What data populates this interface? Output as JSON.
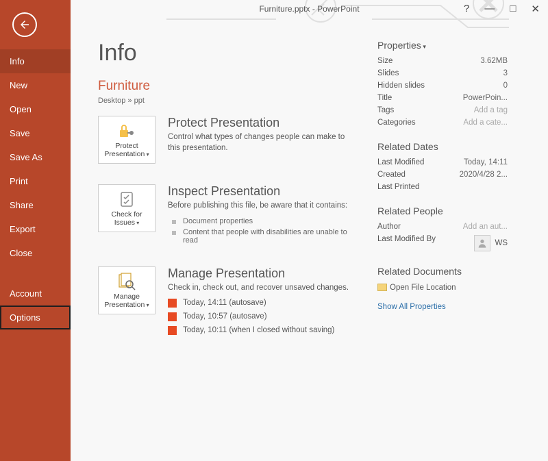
{
  "titlebar": "Furniture.pptx - PowerPoint",
  "sidebar": {
    "items": [
      {
        "label": "Info"
      },
      {
        "label": "New"
      },
      {
        "label": "Open"
      },
      {
        "label": "Save"
      },
      {
        "label": "Save As"
      },
      {
        "label": "Print"
      },
      {
        "label": "Share"
      },
      {
        "label": "Export"
      },
      {
        "label": "Close"
      }
    ],
    "bottom": [
      {
        "label": "Account"
      },
      {
        "label": "Options"
      }
    ]
  },
  "page": {
    "heading": "Info",
    "doc_title": "Furniture",
    "breadcrumb": "Desktop » ppt"
  },
  "sections": {
    "protect": {
      "tile": "Protect Presentation",
      "title": "Protect Presentation",
      "desc": "Control what types of changes people can make to this presentation."
    },
    "inspect": {
      "tile": "Check for Issues",
      "title": "Inspect Presentation",
      "desc": "Before publishing this file, be aware that it contains:",
      "bullets": [
        "Document properties",
        "Content that people with disabilities are unable to read"
      ]
    },
    "manage": {
      "tile": "Manage Presentation",
      "title": "Manage Presentation",
      "desc": "Check in, check out, and recover unsaved changes.",
      "versions": [
        "Today, 14:11 (autosave)",
        "Today, 10:57 (autosave)",
        "Today, 10:11 (when I closed without saving)"
      ]
    }
  },
  "right": {
    "properties_label": "Properties",
    "props": [
      {
        "k": "Size",
        "v": "3.62MB"
      },
      {
        "k": "Slides",
        "v": "3"
      },
      {
        "k": "Hidden slides",
        "v": "0"
      },
      {
        "k": "Title",
        "v": "PowerPoin..."
      },
      {
        "k": "Tags",
        "v": "Add a tag",
        "hint": true
      },
      {
        "k": "Categories",
        "v": "Add a cate...",
        "hint": true
      }
    ],
    "dates_label": "Related Dates",
    "dates": [
      {
        "k": "Last Modified",
        "v": "Today, 14:11"
      },
      {
        "k": "Created",
        "v": "2020/4/28 2..."
      },
      {
        "k": "Last Printed",
        "v": ""
      }
    ],
    "people_label": "Related People",
    "author": {
      "k": "Author",
      "v": "Add an aut...",
      "hint": true
    },
    "modby": {
      "k": "Last Modified By",
      "name": "WS"
    },
    "docs_label": "Related Documents",
    "open_loc": "Open File Location",
    "show_all": "Show All Properties"
  }
}
